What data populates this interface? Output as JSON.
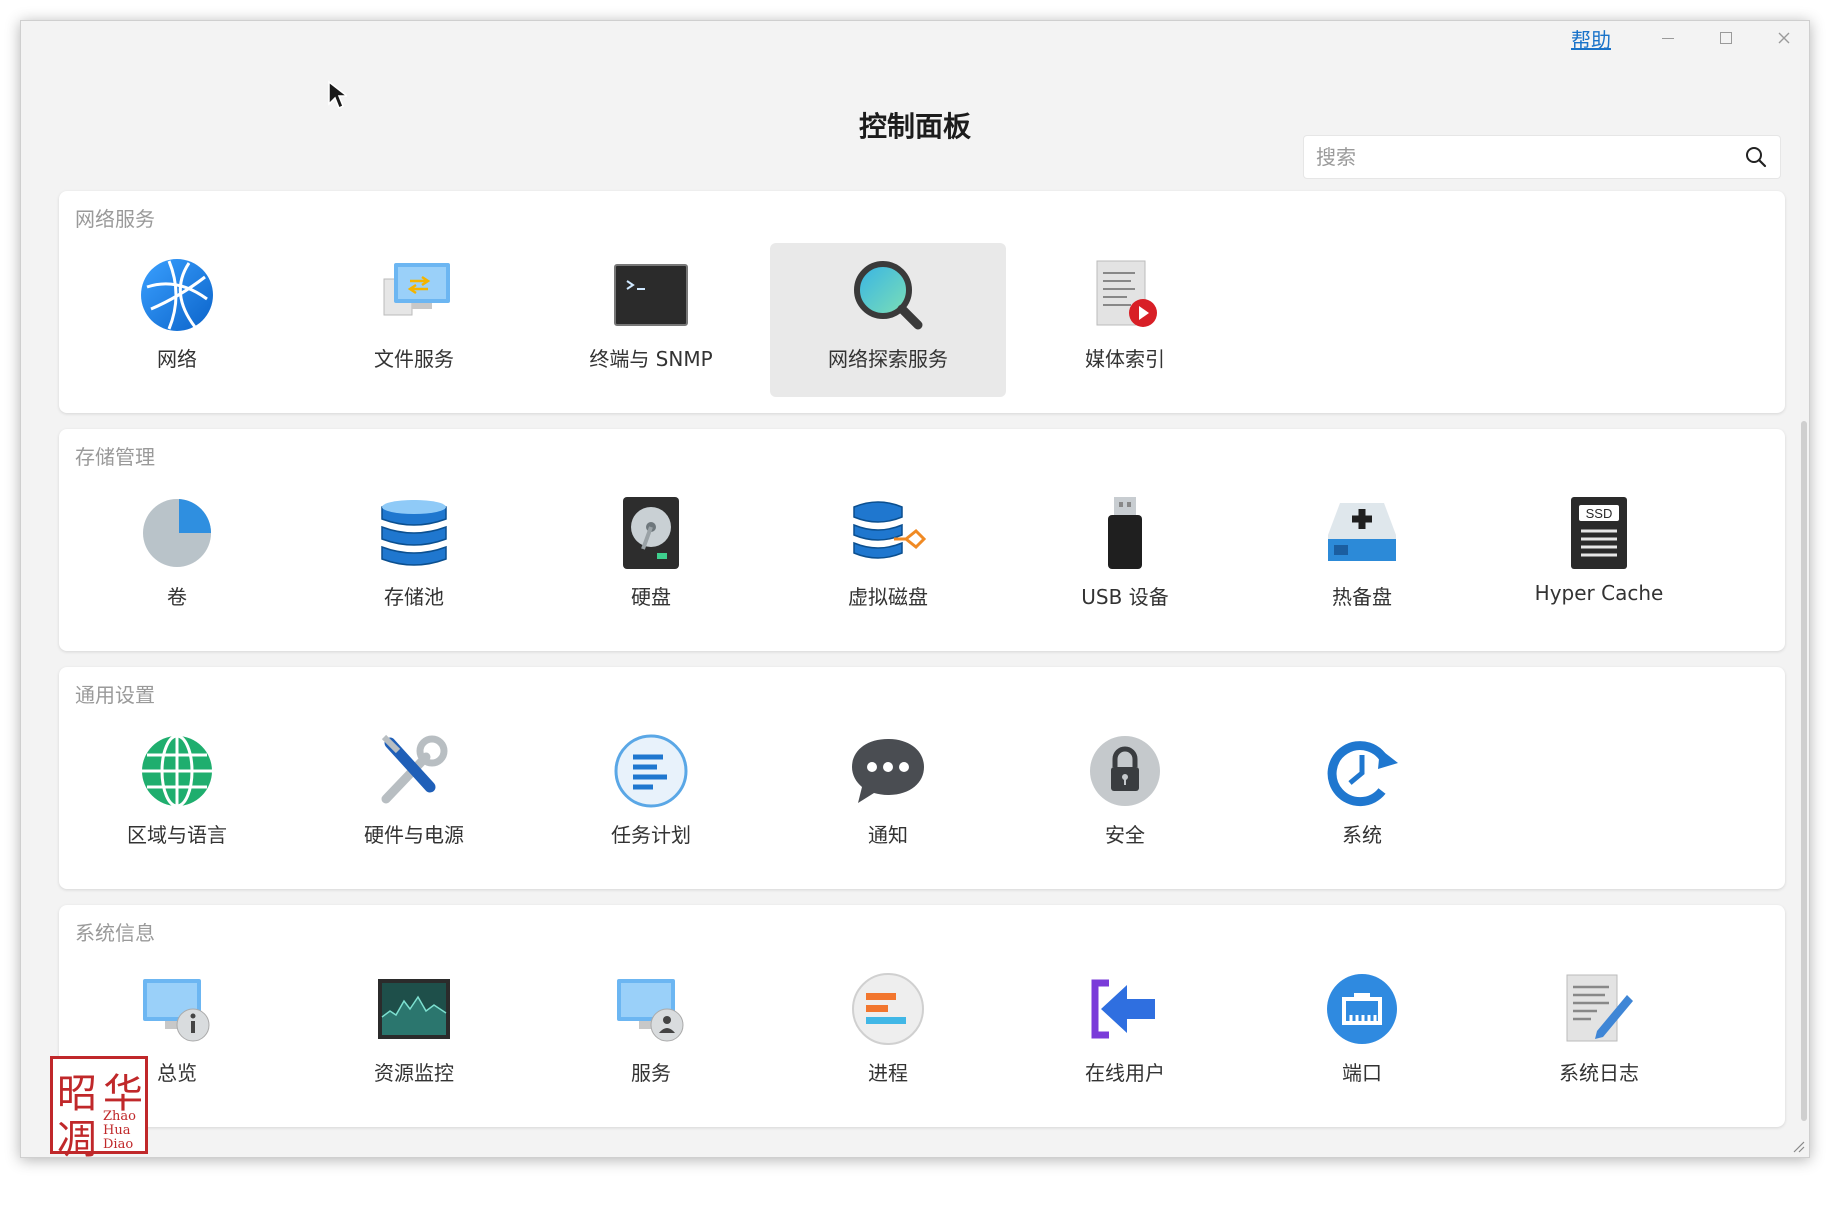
{
  "window": {
    "title": "控制面板",
    "help_label": "帮助",
    "controls": [
      "minimize",
      "maximize",
      "close"
    ]
  },
  "search": {
    "placeholder": "搜索",
    "value": ""
  },
  "sections": [
    {
      "title": "网络服务",
      "items": [
        {
          "label": "网络",
          "icon": "globe-network-icon"
        },
        {
          "label": "文件服务",
          "icon": "file-service-icon"
        },
        {
          "label": "终端与 SNMP",
          "icon": "terminal-icon"
        },
        {
          "label": "网络探索服务",
          "icon": "magnifier-icon",
          "selected": true
        },
        {
          "label": "媒体索引",
          "icon": "media-index-icon"
        }
      ]
    },
    {
      "title": "存储管理",
      "items": [
        {
          "label": "卷",
          "icon": "volume-pie-icon"
        },
        {
          "label": "存储池",
          "icon": "storage-pool-icon"
        },
        {
          "label": "硬盘",
          "icon": "hard-disk-icon"
        },
        {
          "label": "虚拟磁盘",
          "icon": "virtual-disk-icon"
        },
        {
          "label": "USB 设备",
          "icon": "usb-icon"
        },
        {
          "label": "热备盘",
          "icon": "hot-spare-icon"
        },
        {
          "label": "Hyper Cache",
          "icon": "ssd-icon"
        }
      ]
    },
    {
      "title": "通用设置",
      "items": [
        {
          "label": "区域与语言",
          "icon": "region-globe-icon"
        },
        {
          "label": "硬件与电源",
          "icon": "tools-icon"
        },
        {
          "label": "任务计划",
          "icon": "task-plan-icon"
        },
        {
          "label": "通知",
          "icon": "chat-bubble-icon"
        },
        {
          "label": "安全",
          "icon": "lock-icon"
        },
        {
          "label": "系统",
          "icon": "system-clock-icon"
        }
      ]
    },
    {
      "title": "系统信息",
      "items": [
        {
          "label": "总览",
          "icon": "overview-monitor-icon"
        },
        {
          "label": "资源监控",
          "icon": "resource-monitor-icon"
        },
        {
          "label": "服务",
          "icon": "service-monitor-icon"
        },
        {
          "label": "进程",
          "icon": "process-icon"
        },
        {
          "label": "在线用户",
          "icon": "online-user-icon"
        },
        {
          "label": "端口",
          "icon": "port-icon"
        },
        {
          "label": "系统日志",
          "icon": "system-log-icon"
        }
      ]
    }
  ],
  "watermark": {
    "chars": [
      "昭",
      "华",
      "凋"
    ],
    "latin": [
      "Zhao",
      "Hua",
      "Diao"
    ]
  },
  "colors": {
    "accent": "#1a73c9",
    "selected_bg": "#e9e9e9",
    "section_title": "#9a9a9a"
  }
}
